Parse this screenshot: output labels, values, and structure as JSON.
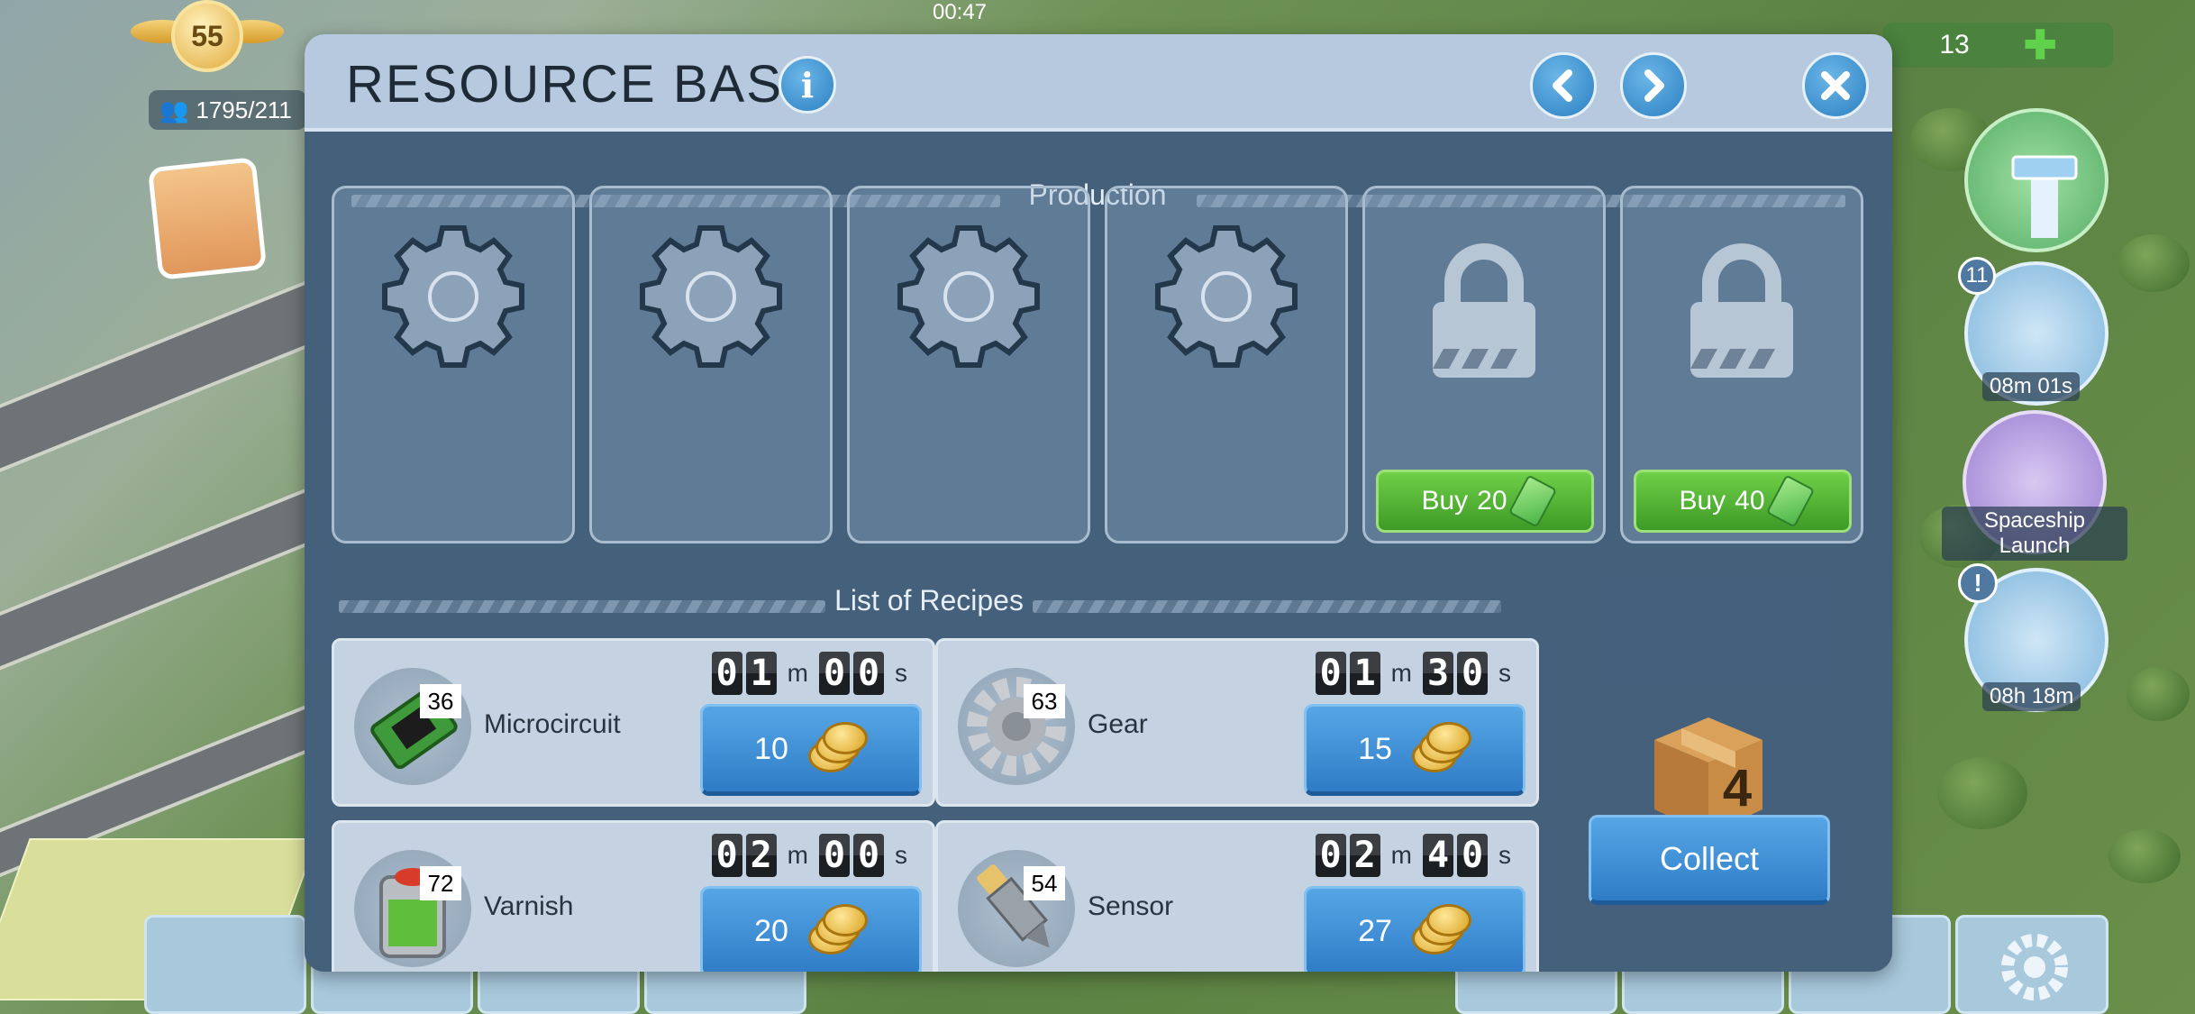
{
  "hud": {
    "level": "55",
    "population": "1795/211",
    "clock": "00:47",
    "cash": "13",
    "radar_badge": "11",
    "radar_timer": "08m 01s",
    "spaceship_label": "Spaceship Launch",
    "speed_timer": "08h 18m"
  },
  "modal": {
    "title": "RESOURCE BASE",
    "production_title": "Production",
    "recipes_title": "List of Recipes",
    "slots": [
      {
        "state": "empty",
        "icon": "gear-icon"
      },
      {
        "state": "empty",
        "icon": "gear-icon"
      },
      {
        "state": "empty",
        "icon": "gear-icon"
      },
      {
        "state": "empty",
        "icon": "gear-icon"
      },
      {
        "state": "locked",
        "icon": "lock-icon",
        "buy_label": "Buy",
        "buy_price": "20"
      },
      {
        "state": "locked",
        "icon": "lock-icon",
        "buy_label": "Buy",
        "buy_price": "40"
      }
    ],
    "recipes": [
      {
        "name": "Microcircuit",
        "count": "36",
        "time": [
          "0",
          "1",
          "0",
          "0"
        ],
        "price": "10",
        "icon": "microcircuit-icon"
      },
      {
        "name": "Gear",
        "count": "63",
        "time": [
          "0",
          "1",
          "3",
          "0"
        ],
        "price": "15",
        "icon": "gear-part-icon"
      },
      {
        "name": "Varnish",
        "count": "72",
        "time": [
          "0",
          "2",
          "0",
          "0"
        ],
        "price": "20",
        "icon": "varnish-icon"
      },
      {
        "name": "Sensor",
        "count": "54",
        "time": [
          "0",
          "2",
          "4",
          "0"
        ],
        "price": "27",
        "icon": "sensor-icon"
      }
    ],
    "time_units": {
      "min": "m",
      "sec": "s"
    },
    "box_count": "4",
    "collect_label": "Collect"
  },
  "colors": {
    "header": "#b6c9de",
    "body": "#46627e",
    "button_blue": "#2f7cc6",
    "button_green": "#3d9a26"
  }
}
